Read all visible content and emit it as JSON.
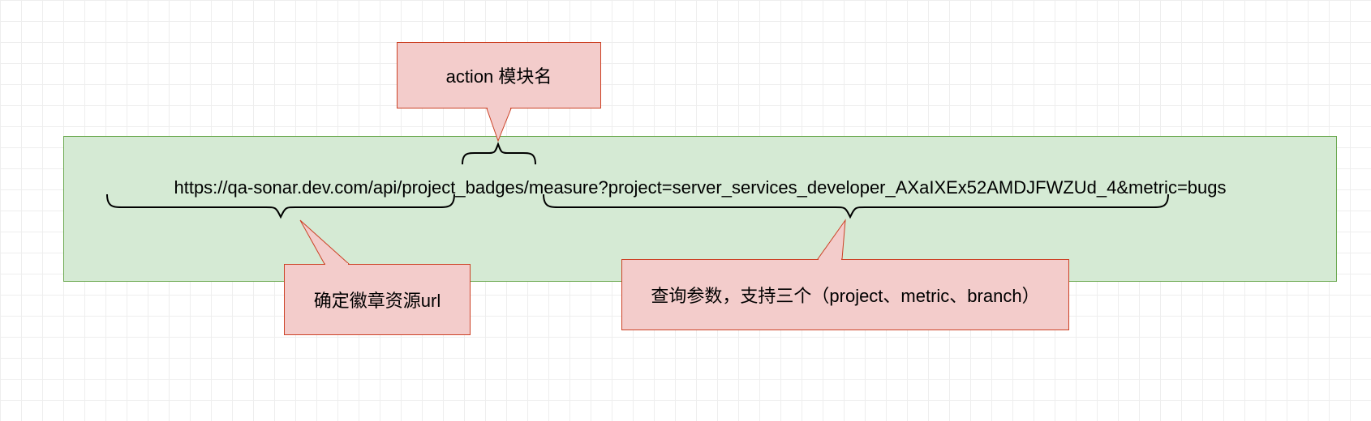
{
  "colors": {
    "grid": "#eeeeee",
    "url_box_fill": "#d5ead4",
    "url_box_stroke": "#6aa84f",
    "callout_fill": "#f3cccb",
    "callout_stroke": "#cc4125",
    "brace_stroke": "#000000",
    "tail_stroke": "#cc4125"
  },
  "url": {
    "full": "https://qa-sonar.dev.com/api/project_badges/measure?project=server_services_developer_AXaIXEx52AMDJFWZUd_4&metric=bugs",
    "segments": {
      "base": "https://qa-sonar.dev.com/api/project_badges",
      "action": "measure",
      "query": "project=server_services_developer_AXaIXEx52AMDJFWZUd_4&metric=bugs"
    }
  },
  "callouts": {
    "top": {
      "label": "action 模块名",
      "points_to": "action segment (measure)"
    },
    "bottom_left": {
      "label": "确定徽章资源url",
      "points_to": "base URL segment"
    },
    "bottom_right": {
      "label": "查询参数，支持三个（project、metric、branch）",
      "points_to": "query string segment"
    }
  }
}
